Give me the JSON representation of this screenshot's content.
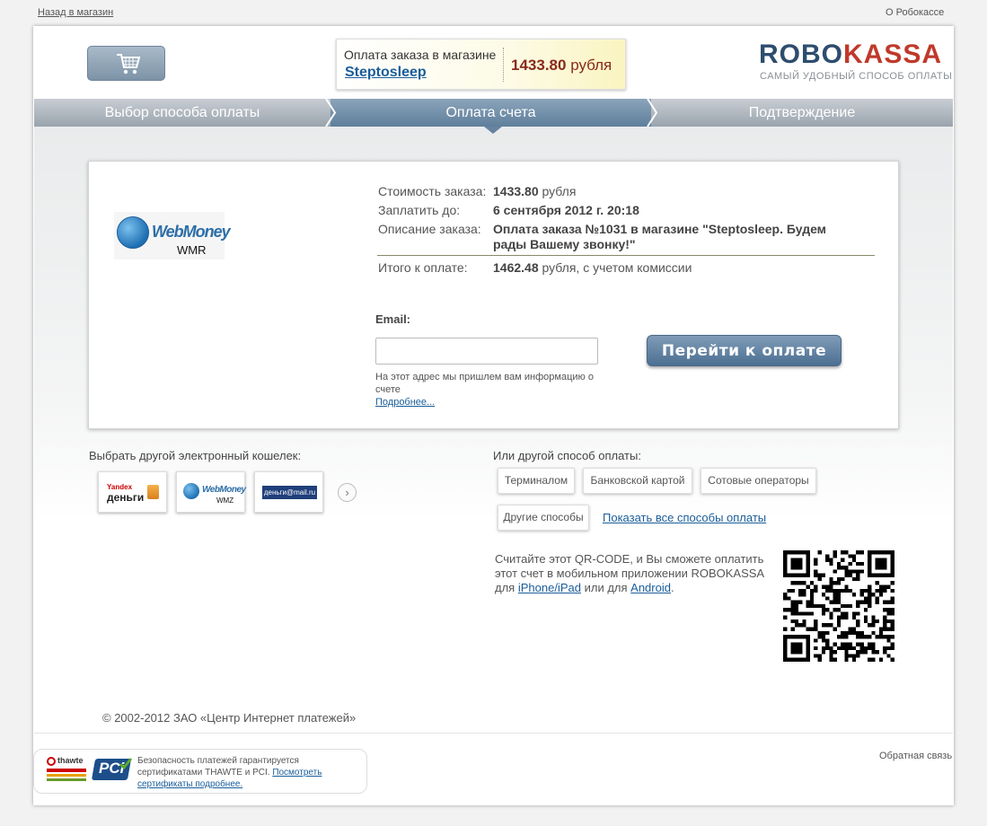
{
  "toplinks": {
    "back": "Назад в магазин",
    "about": "О Робокассе"
  },
  "order": {
    "title": "Оплата заказа в магазине",
    "shop": "Steptosleep",
    "amount": "1433.80",
    "currency": "рубля"
  },
  "logo": {
    "part1": "ROBO",
    "part2": "KASSA",
    "slogan": "САМЫЙ УДОБНЫЙ СПОСОБ ОПЛАТЫ"
  },
  "steps": {
    "step1": "Выбор способа оплаты",
    "step2": "Оплата счета",
    "step3": "Подтверждение"
  },
  "payment_logo": {
    "name": "WebMoney",
    "currency": "WMR"
  },
  "details": {
    "cost_label": "Стоимость заказа:",
    "cost_value": "1433.80",
    "cost_unit": "рубля",
    "due_label": "Заплатить до:",
    "due_value": "6 сентября 2012 г. 20:18",
    "desc_label": "Описание заказа:",
    "desc_value": "Оплата заказа №1031 в магазине \"Steptosleep. Будем рады Вашему звонку!\"",
    "total_label": "Итого к оплате:",
    "total_value": "1462.48",
    "total_unit": "рубля, с учетом комиссии"
  },
  "email": {
    "label": "Email:",
    "value": "",
    "placeholder": "",
    "hint": "На этот адрес мы пришлем вам информацию о счете",
    "more": "Подробнее..."
  },
  "pay_button": "Перейти к оплате",
  "wallets": {
    "title": "Выбрать другой электронный кошелек:",
    "items": [
      {
        "line1": "Yandex",
        "line2": "деньги"
      },
      {
        "line1": "WebMoney",
        "line2": "WMZ"
      },
      {
        "line1": "деньги@mail.ru"
      }
    ]
  },
  "methods": {
    "title": "Или другой способ оплаты:",
    "items": [
      "Терминалом",
      "Банковской картой",
      "Сотовые операторы",
      "Другие способы"
    ],
    "show_all": "Показать все способы оплаты"
  },
  "qr": {
    "text": "Считайте этот QR-CODE, и Вы сможете оплатить этот счет в мобильном приложении ROBOKASSA для",
    "link1": "iPhone/iPad",
    "middle": "или для",
    "link2": "Android",
    "end": "."
  },
  "footer": {
    "copyright": "© 2002-2012 ЗАО «Центр Интернет платежей»",
    "cert_text": "Безопасность платежей гарантируется сертификатами THAWTE и PCI.",
    "cert_link": "Посмотреть сертификаты подробнее.",
    "feedback": "Обратная связь",
    "thawte": "thawte",
    "pci": "PCi"
  }
}
